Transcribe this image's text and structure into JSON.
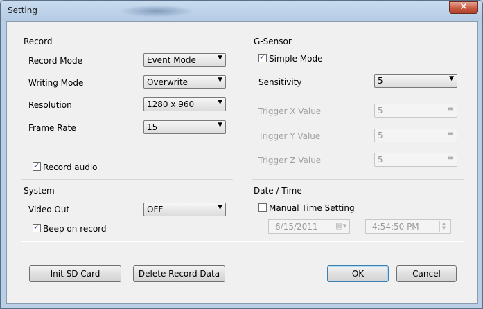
{
  "window": {
    "title": "Setting",
    "close_symbol": "✕"
  },
  "record": {
    "group_label": "Record",
    "mode_label": "Record Mode",
    "mode_value": "Event Mode",
    "writing_label": "Writing Mode",
    "writing_value": "Overwrite",
    "resolution_label": "Resolution",
    "resolution_value": "1280 x 960",
    "framerate_label": "Frame Rate",
    "framerate_value": "15",
    "audio_label": "Record audio",
    "audio_checked": true
  },
  "gsensor": {
    "group_label": "G-Sensor",
    "simple_label": "Simple Mode",
    "simple_checked": true,
    "sensitivity_label": "Sensitivity",
    "sensitivity_value": "5",
    "x_label": "Trigger X Value",
    "x_value": "5",
    "y_label": "Trigger Y Value",
    "y_value": "5",
    "z_label": "Trigger Z Value",
    "z_value": "5"
  },
  "system": {
    "group_label": "System",
    "video_label": "Video Out",
    "video_value": "OFF",
    "beep_label": "Beep on record",
    "beep_checked": true
  },
  "datetime": {
    "group_label": "Date / Time",
    "manual_label": "Manual Time Setting",
    "manual_checked": false,
    "date_value": "6/15/2011",
    "time_value": "4:54:50 PM"
  },
  "buttons": {
    "init_sd": "Init SD Card",
    "delete_data": "Delete Record Data",
    "ok": "OK",
    "cancel": "Cancel"
  }
}
